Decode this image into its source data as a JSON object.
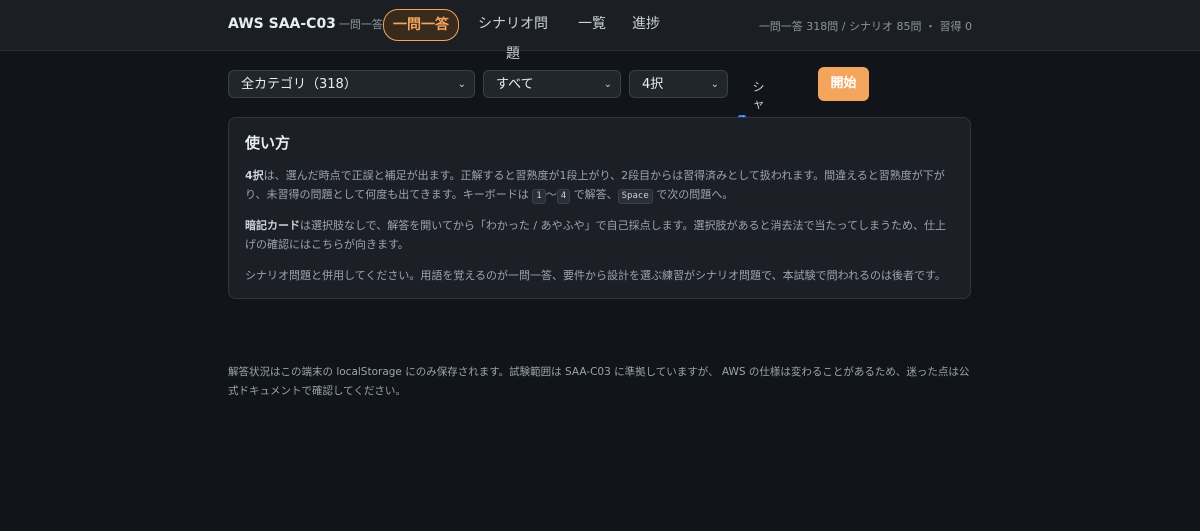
{
  "header": {
    "title": "AWS SAA-C03",
    "subtitle": "一問一答",
    "tabs": [
      {
        "label": "一問一答",
        "active": true
      },
      {
        "label": "シナリオ問題",
        "active": false
      },
      {
        "label": "一覧",
        "active": false
      },
      {
        "label": "進捗",
        "active": false
      }
    ],
    "stats": "一問一答 318問 / シナリオ 85問 ・ 習得 0"
  },
  "controls": {
    "category_value": "全カテゴリ（318）",
    "filter_value": "すべて",
    "mode_value": "4択",
    "shuffle_label": "シャッフル",
    "shuffle_checked": true,
    "start_label": "開始"
  },
  "howto": {
    "title": "使い方",
    "p1": {
      "strong": "4択",
      "text_a": "は、選んだ時点で正誤と補足が出ます。正解すると習熟度が1段上がり、2段目からは習得済みとして扱われます。間違えると習熟度が下がり、未習得の問題として何度も出てきます。キーボードは ",
      "key_start": "1",
      "tilde": "〜",
      "key_end": "4",
      "text_b": " で解答、",
      "key_space": "Space",
      "text_c": " で次の問題へ。"
    },
    "p2": {
      "strong": "暗記カード",
      "text": "は選択肢なしで、解答を開いてから「わかった / あやふや」で自己採点します。選択肢があると消去法で当たってしまうため、仕上げの確認にはこちらが向きます。"
    },
    "p3": "シナリオ問題と併用してください。用語を覚えるのが一問一答、要件から設計を選ぶ練習がシナリオ問題で、本試験で問われるのは後者です。"
  },
  "footer": {
    "note": "解答状況はこの端末の localStorage にのみ保存されます。試験範囲は SAA-C03 に準拠していますが、 AWS の仕様は変わることがあるため、迷った点は公式ドキュメントで確認してください。"
  },
  "colors": {
    "accent": "#f3a55e",
    "background": "#111418",
    "card": "#1c2026"
  }
}
